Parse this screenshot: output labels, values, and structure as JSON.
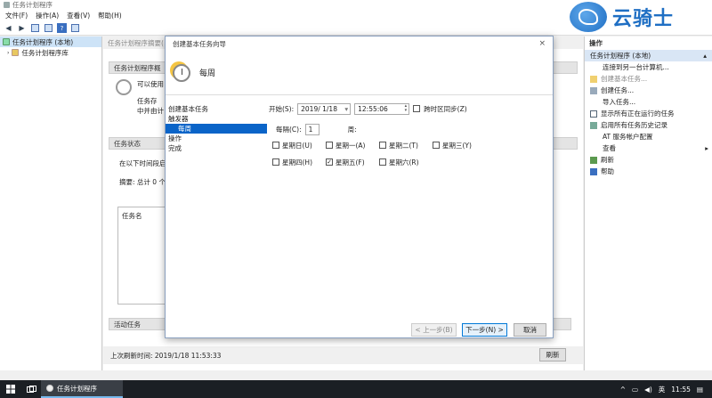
{
  "window": {
    "title": "任务计划程序"
  },
  "menu": [
    "文件(F)",
    "操作(A)",
    "查看(V)",
    "帮助(H)"
  ],
  "logo": {
    "text": "云骑士"
  },
  "tree": [
    "任务计划程序 (本地)",
    "任务计划程序库"
  ],
  "center": {
    "summary_header": "任务计划程序摘要(",
    "overview_header": "任务计划程序概",
    "overview_lines": [
      "可以使用",
      "任务存",
      "中并由计"
    ],
    "status_header": "任务状态",
    "status_line1": "在以下时间段启",
    "status_line2": "摘要: 总计 0 个",
    "tasks_col": "任务名",
    "active_header": "活动任务",
    "last_refresh": "上次刷新时间: 2019/1/18 11:53:33",
    "refresh_button": "刷新"
  },
  "actions": {
    "header": "操作",
    "sub_header": "任务计划程序 (本地)",
    "items": [
      "连接到另一台计算机...",
      "创建基本任务...",
      "创建任务...",
      "导入任务...",
      "显示所有正在运行的任务",
      "启用所有任务历史记录",
      "AT 服务帐户配置",
      "查看",
      "刷新",
      "帮助"
    ]
  },
  "dialog": {
    "title": "创建基本任务向导",
    "close": "×",
    "heading": "每周",
    "steps": [
      "创建基本任务",
      "触发器",
      "每周",
      "操作",
      "完成"
    ],
    "start_label": "开始(S):",
    "start_date": "2019/ 1/18",
    "start_time": "12:55:06",
    "sync_label": "跨时区同步(Z)",
    "every_label": "每隔(C):",
    "every_value": "1",
    "week_label": "周:",
    "days": [
      {
        "label": "星期日(U)",
        "checked": false
      },
      {
        "label": "星期一(A)",
        "checked": false
      },
      {
        "label": "星期二(T)",
        "checked": false
      },
      {
        "label": "星期三(Y)",
        "checked": false
      },
      {
        "label": "星期四(H)",
        "checked": false
      },
      {
        "label": "星期五(F)",
        "checked": true
      },
      {
        "label": "星期六(R)",
        "checked": false
      }
    ],
    "back_button": "< 上一步(B)",
    "next_button": "下一步(N) >",
    "cancel_button": "取消"
  },
  "taskbar": {
    "app": "任务计划程序",
    "ime": "英",
    "time": "11:55"
  }
}
